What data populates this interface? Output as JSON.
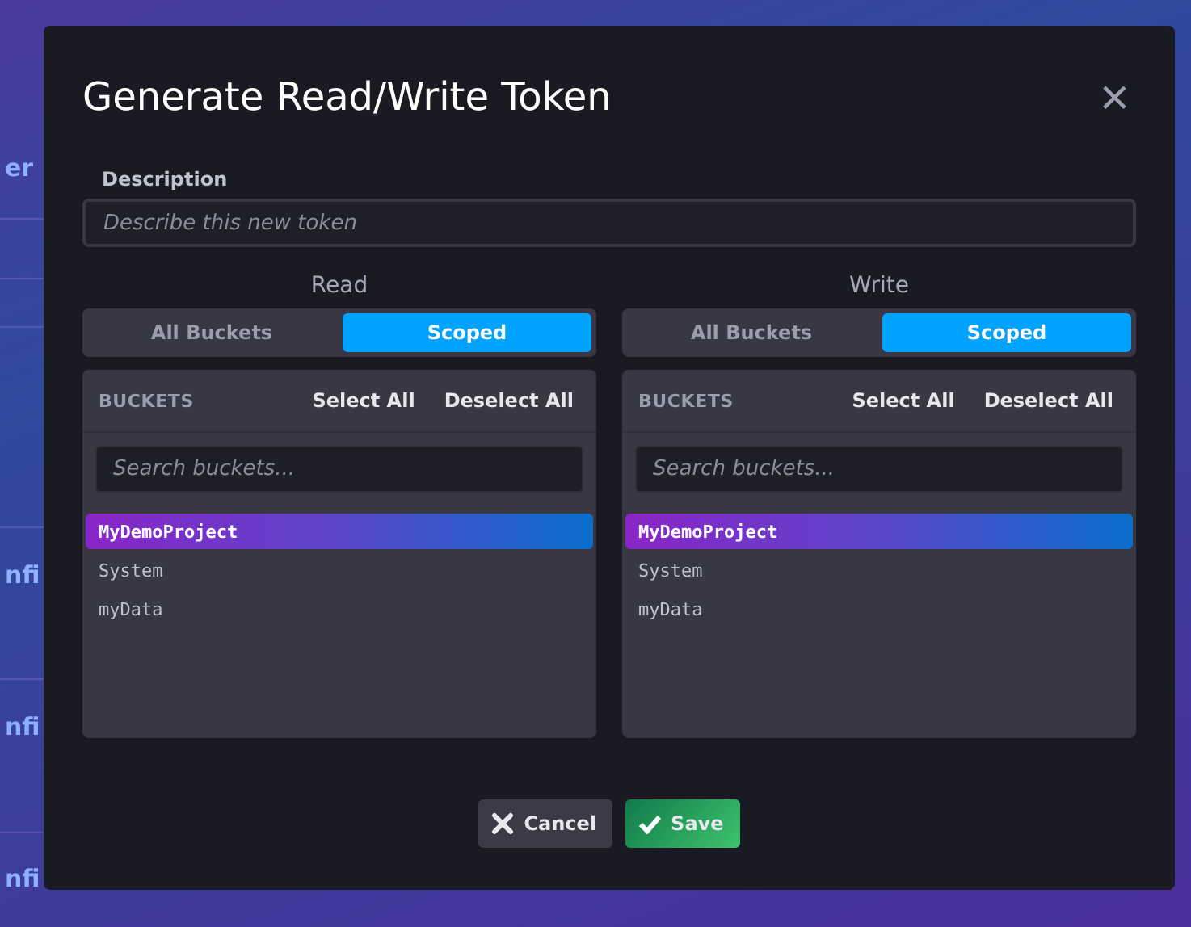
{
  "background": {
    "rows": [
      "er",
      "nfi",
      "nfi",
      "nfi"
    ]
  },
  "dialog": {
    "title": "Generate Read/Write Token",
    "close": "×",
    "description": {
      "label": "Description",
      "placeholder": "Describe this new token"
    },
    "panels": [
      {
        "title": "Read",
        "modes": [
          {
            "label": "All Buckets",
            "selected": false
          },
          {
            "label": "Scoped",
            "selected": true
          }
        ],
        "header": "BUCKETS",
        "select_all": "Select All",
        "deselect_all": "Deselect All",
        "search": {
          "placeholder": "Search buckets..."
        },
        "buckets": [
          {
            "name": "MyDemoProject",
            "selected": true
          },
          {
            "name": "System",
            "selected": false
          },
          {
            "name": "myData",
            "selected": false
          }
        ]
      },
      {
        "title": "Write",
        "modes": [
          {
            "label": "All Buckets",
            "selected": false
          },
          {
            "label": "Scoped",
            "selected": true
          }
        ],
        "header": "BUCKETS",
        "select_all": "Select All",
        "deselect_all": "Deselect All",
        "search": {
          "placeholder": "Search buckets..."
        },
        "buckets": [
          {
            "name": "MyDemoProject",
            "selected": true
          },
          {
            "name": "System",
            "selected": false
          },
          {
            "name": "myData",
            "selected": false
          }
        ]
      }
    ],
    "buttons": [
      {
        "kind": "cancel",
        "label": "Cancel"
      },
      {
        "kind": "save",
        "label": "Save"
      }
    ]
  }
}
